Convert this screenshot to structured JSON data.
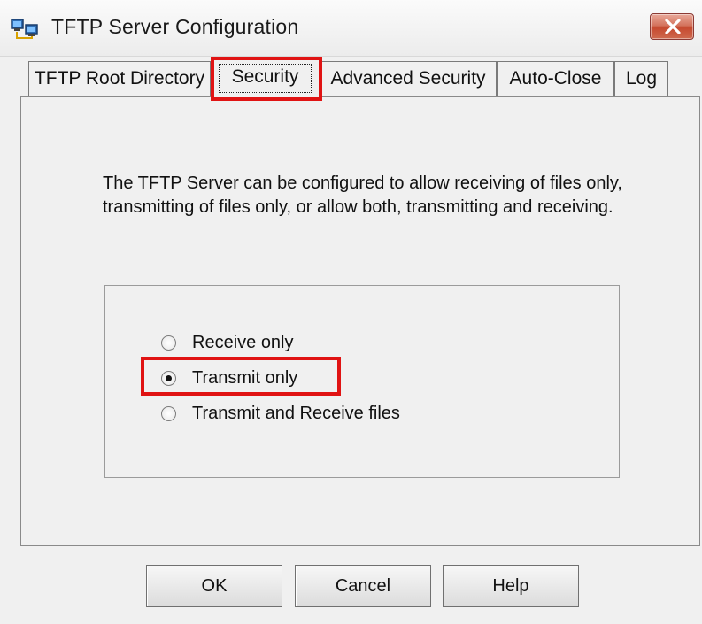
{
  "window": {
    "title": "TFTP Server Configuration",
    "app_icon": "network-computers-icon",
    "close_icon": "close-icon"
  },
  "tabs": [
    {
      "label": "TFTP Root Directory",
      "active": false
    },
    {
      "label": "Security",
      "active": true
    },
    {
      "label": "Advanced Security",
      "active": false
    },
    {
      "label": "Auto-Close",
      "active": false
    },
    {
      "label": "Log",
      "active": false
    }
  ],
  "security": {
    "description": "The TFTP Server can be configured to allow receiving of files only, transmitting of files only, or allow both, transmitting and receiving.",
    "options": [
      {
        "label": "Receive only",
        "selected": false
      },
      {
        "label": "Transmit only",
        "selected": true
      },
      {
        "label": "Transmit and Receive files",
        "selected": false
      }
    ]
  },
  "buttons": {
    "ok": "OK",
    "cancel": "Cancel",
    "help": "Help"
  },
  "colors": {
    "highlight": "#e01313",
    "close_button": "#c64a30"
  }
}
